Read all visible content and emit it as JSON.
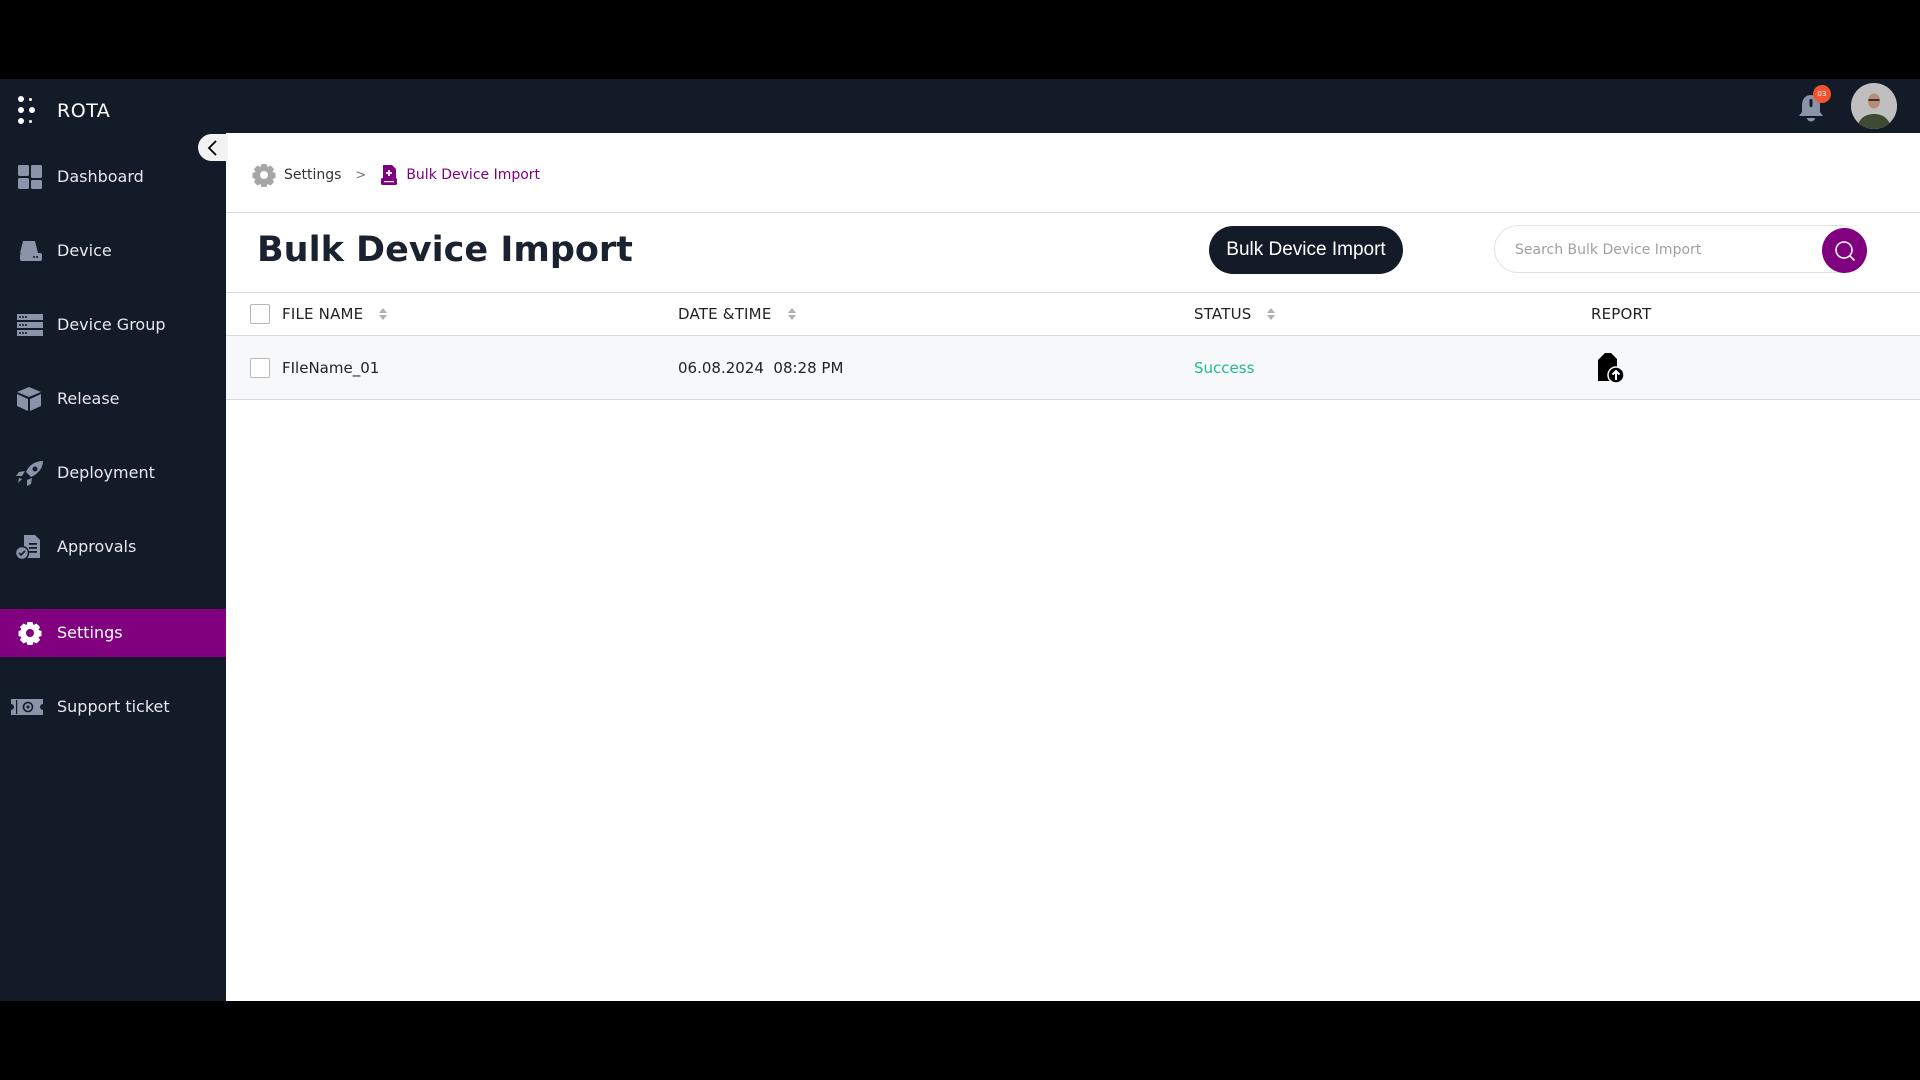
{
  "app": {
    "name": "ROTA"
  },
  "header": {
    "notifications_count": "03",
    "avatar_alt": "User avatar"
  },
  "sidebar": {
    "items": [
      {
        "label": "Dashboard",
        "icon": "dashboard-icon",
        "active": false
      },
      {
        "label": "Device",
        "icon": "device-icon",
        "active": false
      },
      {
        "label": "Device Group",
        "icon": "device-group-icon",
        "active": false
      },
      {
        "label": "Release",
        "icon": "box-icon",
        "active": false
      },
      {
        "label": "Deployment",
        "icon": "rocket-icon",
        "active": false
      },
      {
        "label": "Approvals",
        "icon": "approvals-icon",
        "active": false
      },
      {
        "label": "Settings",
        "icon": "gear-icon",
        "active": true
      },
      {
        "label": "Support ticket",
        "icon": "ticket-icon",
        "active": false
      }
    ]
  },
  "breadcrumb": {
    "items": [
      {
        "label": "Settings",
        "icon": "gear-icon"
      },
      {
        "label": "Bulk Device Import",
        "icon": "device-import-icon"
      }
    ],
    "separator": ">"
  },
  "page": {
    "title": "Bulk Device Import",
    "action_button": "Bulk Device Import",
    "search": {
      "placeholder": "Search Bulk Device Import",
      "value": ""
    }
  },
  "table": {
    "columns": [
      {
        "label": "FILE NAME",
        "sortable": true
      },
      {
        "label": "DATE &TIME",
        "sortable": true
      },
      {
        "label": "STATUS",
        "sortable": true
      },
      {
        "label": "REPORT",
        "sortable": false
      }
    ],
    "rows": [
      {
        "file_name": "FIleName_01",
        "date_time": "06.08.2024  08:28 PM",
        "status": "Success",
        "report_icon": "file-upload-icon"
      }
    ]
  },
  "colors": {
    "sidebar_bg": "#131a28",
    "accent": "#800080",
    "success": "#22b893",
    "badge": "#f0532d"
  }
}
